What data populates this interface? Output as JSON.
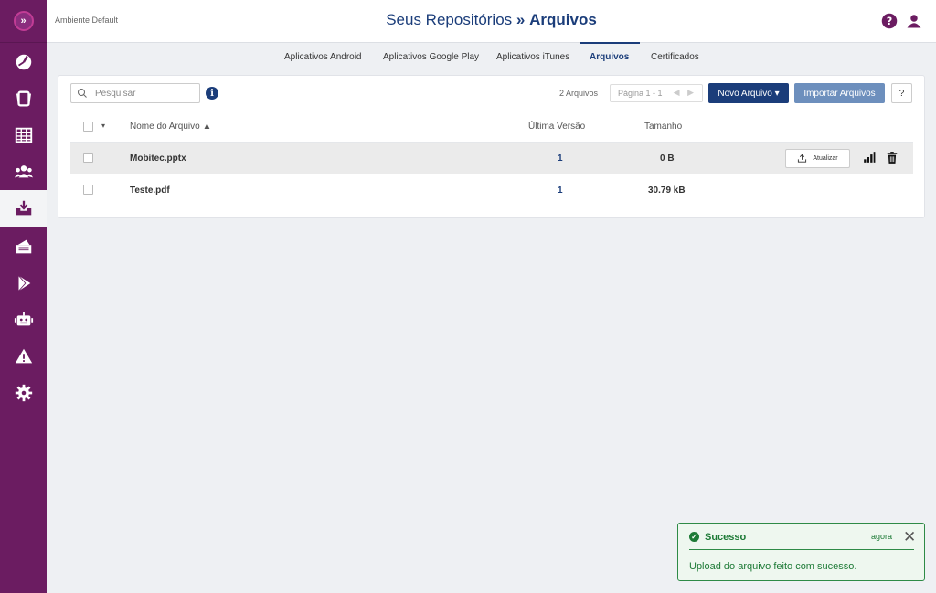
{
  "header": {
    "environment": "Ambiente Default",
    "title_prefix": "Seus Repositórios",
    "title_separator": "»",
    "title_current": "Arquivos"
  },
  "tabs": [
    {
      "label": "Aplicativos Android"
    },
    {
      "label": "Aplicativos Google Play"
    },
    {
      "label": "Aplicativos iTunes"
    },
    {
      "label": "Arquivos",
      "active": true
    },
    {
      "label": "Certificados"
    }
  ],
  "toolbar": {
    "search_placeholder": "Pesquisar",
    "info_glyph": "i",
    "count": "2 Arquivos",
    "pager_text": "Página 1 - 1",
    "pager_arrows": "◀ ▶",
    "new_file_label": "Novo Arquivo ▾",
    "import_label": "Importar Arquivos",
    "help_label": "?"
  },
  "table": {
    "columns": {
      "name": "Nome do Arquivo ▲",
      "version": "Última Versão",
      "size": "Tamanho"
    },
    "select_dropdown": "▾",
    "rows": [
      {
        "name": "Mobitec.pptx",
        "version": "1",
        "size": "0 B",
        "highlighted": true,
        "update_label": "Atualizar"
      },
      {
        "name": "Teste.pdf",
        "version": "1",
        "size": "30.79 kB",
        "highlighted": false
      }
    ]
  },
  "toast": {
    "title": "Sucesso",
    "time": "agora",
    "close": "✕",
    "message": "Upload do arquivo feito com sucesso.",
    "check": "✓"
  },
  "sidebar": {
    "logo_glyph": "»",
    "icons": [
      "dashboard-icon",
      "devices-icon",
      "grid-icon",
      "users-icon",
      "repository-icon",
      "policies-icon",
      "play-store-icon",
      "robot-icon",
      "alert-icon",
      "settings-icon"
    ],
    "active_index": 4
  },
  "colors": {
    "sidebar": "#6b1c61",
    "primary": "#1b3d7a",
    "success": "#1d7a36"
  }
}
